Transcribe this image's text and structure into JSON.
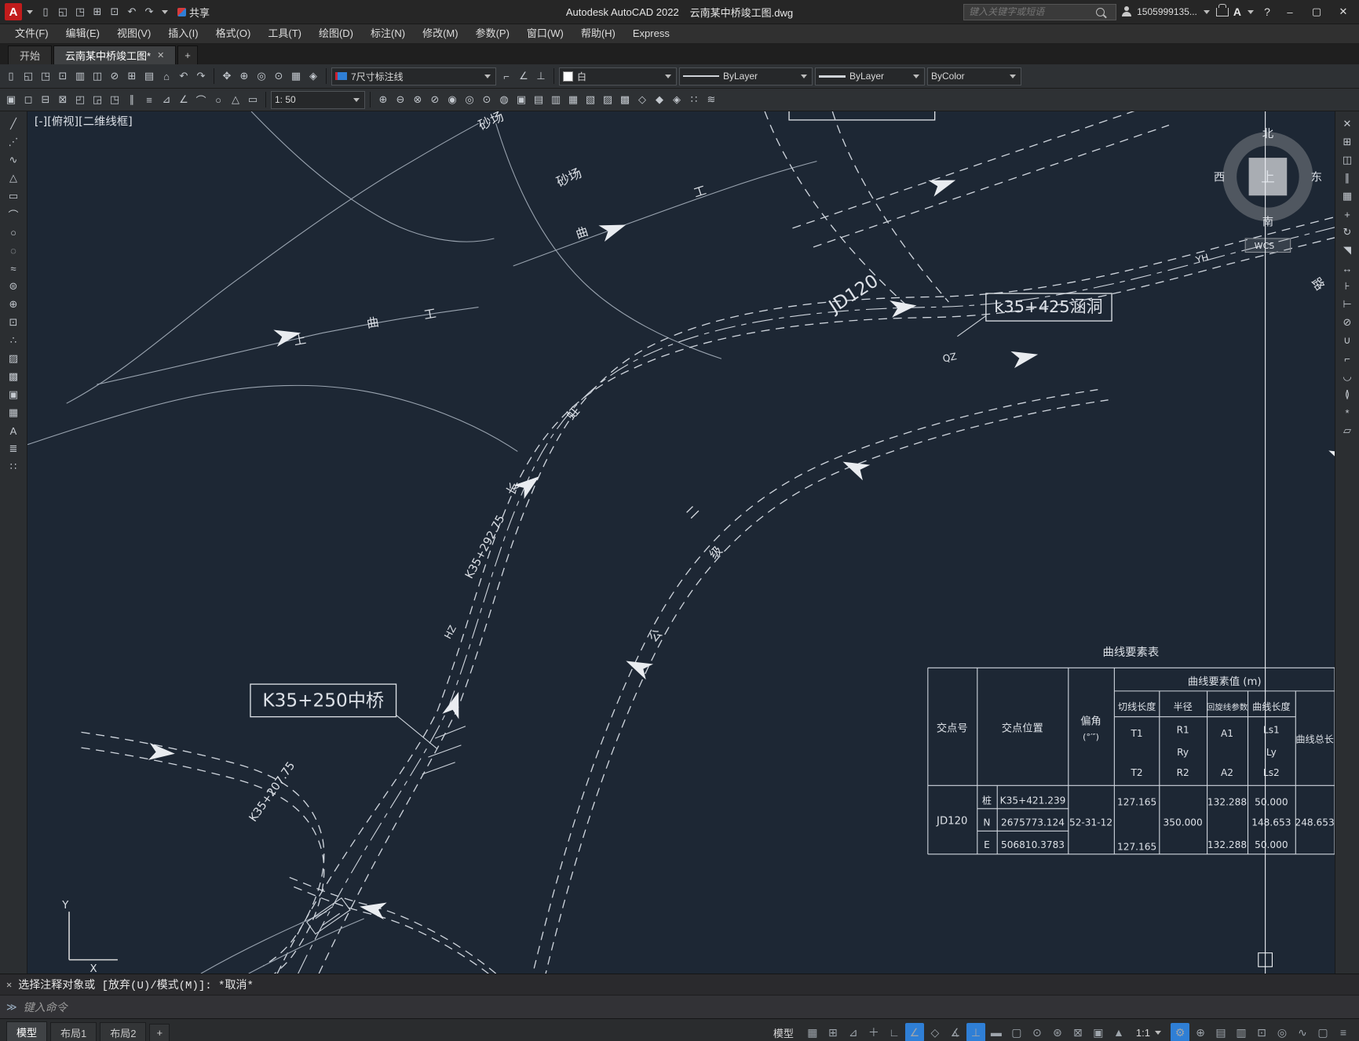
{
  "window": {
    "logo": "A",
    "app_title": "Autodesk AutoCAD 2022",
    "doc_title": "云南某中桥竣工图.dwg",
    "share": "共享",
    "search_placeholder": "键入关键字或短语",
    "user_id": "1505999135...",
    "help": "?",
    "minimize": "–",
    "maximize": "▢",
    "close": "✕"
  },
  "title_icons": [
    {
      "name": "new-file-icon",
      "glyph": "▯"
    },
    {
      "name": "open-folder-icon",
      "glyph": "◱"
    },
    {
      "name": "save-icon",
      "glyph": "◳"
    },
    {
      "name": "save-as-icon",
      "glyph": "⊞"
    },
    {
      "name": "plot-icon",
      "glyph": "⊡"
    },
    {
      "name": "undo-icon",
      "glyph": "↶"
    },
    {
      "name": "redo-icon",
      "glyph": "↷"
    }
  ],
  "menu": {
    "items": [
      "文件(F)",
      "编辑(E)",
      "视图(V)",
      "插入(I)",
      "格式(O)",
      "工具(T)",
      "绘图(D)",
      "标注(N)",
      "修改(M)",
      "参数(P)",
      "窗口(W)",
      "帮助(H)",
      "Express"
    ]
  },
  "tabs": {
    "start": "开始",
    "doc": "云南某中桥竣工图*",
    "close": "✕",
    "add": "+"
  },
  "tb1": {
    "g1": [
      {
        "name": "new-icon",
        "glyph": "▯"
      },
      {
        "name": "open-icon",
        "glyph": "◱"
      },
      {
        "name": "save-icon",
        "glyph": "◳"
      },
      {
        "name": "plot-icon",
        "glyph": "⊡"
      },
      {
        "name": "preview-icon",
        "glyph": "▥"
      },
      {
        "name": "publish-icon",
        "glyph": "◫"
      },
      {
        "name": "cut-icon",
        "glyph": "⊘"
      },
      {
        "name": "copy-clip-icon",
        "glyph": "⊞"
      },
      {
        "name": "paste-icon",
        "glyph": "▤"
      },
      {
        "name": "match-properties-icon",
        "glyph": "⌂"
      },
      {
        "name": "undo-icon",
        "glyph": "↶"
      },
      {
        "name": "redo-icon",
        "glyph": "↷"
      }
    ],
    "g2": [
      {
        "name": "pan-icon",
        "glyph": "✥"
      },
      {
        "name": "zoom-realtime-icon",
        "glyph": "⊕"
      },
      {
        "name": "zoom-window-icon",
        "glyph": "◎"
      },
      {
        "name": "zoom-previous-icon",
        "glyph": "⊙"
      },
      {
        "name": "properties-icon",
        "glyph": "▦"
      },
      {
        "name": "designcenter-icon",
        "glyph": "◈"
      }
    ],
    "dim_style": "7尺寸标注线",
    "g3": [
      {
        "name": "dim-linear-icon",
        "glyph": "⌐"
      },
      {
        "name": "dim-angular-icon",
        "glyph": "∠"
      },
      {
        "name": "dim-radius-icon",
        "glyph": "⊥"
      }
    ],
    "color_label": "白",
    "linetype": "ByLayer",
    "lineweight": "ByLayer",
    "plot_style": "ByColor"
  },
  "tb2": {
    "h1": [
      {
        "name": "layer-properties-icon",
        "glyph": "▣"
      },
      {
        "name": "layer-off-icon",
        "glyph": "◻"
      },
      {
        "name": "layer-freeze-icon",
        "glyph": "⊟"
      },
      {
        "name": "layer-lock-icon",
        "glyph": "⊠"
      },
      {
        "name": "layer-prev-icon",
        "glyph": "◰"
      },
      {
        "name": "layer-state-icon",
        "glyph": "◲"
      },
      {
        "name": "make-current-icon",
        "glyph": "◳"
      },
      {
        "name": "layer-walk-icon",
        "glyph": "∥"
      },
      {
        "name": "layer-merge-icon",
        "glyph": "≡"
      },
      {
        "name": "annotate-icon",
        "glyph": "⊿"
      },
      {
        "name": "mleader-icon",
        "glyph": "∠"
      },
      {
        "name": "arc-tool-icon",
        "glyph": "⌒"
      },
      {
        "name": "circle-tool-icon",
        "glyph": "○"
      },
      {
        "name": "polygon-tool-icon",
        "glyph": "△"
      },
      {
        "name": "rect-tool-icon",
        "glyph": "▭"
      }
    ],
    "scale": "1: 50",
    "h2": [
      {
        "name": "scale-list-icon",
        "glyph": "⊕"
      },
      {
        "name": "ann-update-icon",
        "glyph": "⊖"
      },
      {
        "name": "ann-sync-icon",
        "glyph": "⊗"
      },
      {
        "name": "field-icon",
        "glyph": "⊘"
      },
      {
        "name": "group-icon",
        "glyph": "◉"
      },
      {
        "name": "ungroup-icon",
        "glyph": "◎"
      },
      {
        "name": "group-edit-icon",
        "glyph": "⊙"
      },
      {
        "name": "measure-icon",
        "glyph": "◍"
      },
      {
        "name": "quickcalc-icon",
        "glyph": "▣"
      },
      {
        "name": "block-editor-icon",
        "glyph": "▤"
      },
      {
        "name": "xref-icon",
        "glyph": "▥"
      },
      {
        "name": "image-attach-icon",
        "glyph": "▦"
      },
      {
        "name": "hatch-edit-icon",
        "glyph": "▧"
      },
      {
        "name": "boundary-icon",
        "glyph": "▨"
      },
      {
        "name": "region-icon",
        "glyph": "▩"
      },
      {
        "name": "point-style-icon",
        "glyph": "◇"
      },
      {
        "name": "multiline-icon",
        "glyph": "◆"
      },
      {
        "name": "revcloud-icon",
        "glyph": "◈"
      },
      {
        "name": "divide-icon",
        "glyph": "∷"
      },
      {
        "name": "wipeout-icon",
        "glyph": "≋"
      }
    ]
  },
  "palette_left": [
    {
      "name": "line-tool-icon",
      "glyph": "╱"
    },
    {
      "name": "construction-line-icon",
      "glyph": "⋰"
    },
    {
      "name": "polyline-icon",
      "glyph": "∿"
    },
    {
      "name": "polygon-icon",
      "glyph": "△"
    },
    {
      "name": "rectangle-icon",
      "glyph": "▭"
    },
    {
      "name": "arc-icon",
      "glyph": "⌒"
    },
    {
      "name": "circle-icon",
      "glyph": "○"
    },
    {
      "name": "revision-cloud-icon",
      "glyph": "◌"
    },
    {
      "name": "spline-icon",
      "glyph": "≈"
    },
    {
      "name": "ellipse-icon",
      "glyph": "⊜"
    },
    {
      "name": "insert-block-icon",
      "glyph": "⊕"
    },
    {
      "name": "create-block-icon",
      "glyph": "⊡"
    },
    {
      "name": "point-icon",
      "glyph": "∴"
    },
    {
      "name": "hatch-icon",
      "glyph": "▨"
    },
    {
      "name": "gradient-icon",
      "glyph": "▩"
    },
    {
      "name": "region-icon",
      "glyph": "▣"
    },
    {
      "name": "table-icon",
      "glyph": "▦"
    },
    {
      "name": "text-icon",
      "glyph": "A"
    },
    {
      "name": "mtext-icon",
      "glyph": "≣"
    },
    {
      "name": "point-cloud-icon",
      "glyph": "∷"
    }
  ],
  "palette_right": [
    {
      "name": "erase-icon",
      "glyph": "✕"
    },
    {
      "name": "copy-icon",
      "glyph": "⊞"
    },
    {
      "name": "mirror-icon",
      "glyph": "◫"
    },
    {
      "name": "offset-icon",
      "glyph": "∥"
    },
    {
      "name": "array-icon",
      "glyph": "▦"
    },
    {
      "name": "move-icon",
      "glyph": "+"
    },
    {
      "name": "rotate-icon",
      "glyph": "↻"
    },
    {
      "name": "scale-icon",
      "glyph": "◥"
    },
    {
      "name": "stretch-icon",
      "glyph": "↔"
    },
    {
      "name": "trim-icon",
      "glyph": "⊦"
    },
    {
      "name": "extend-icon",
      "glyph": "⊢"
    },
    {
      "name": "break-icon",
      "glyph": "⊘"
    },
    {
      "name": "join-icon",
      "glyph": "∪"
    },
    {
      "name": "chamfer-icon",
      "glyph": "⌐"
    },
    {
      "name": "fillet-icon",
      "glyph": "◡"
    },
    {
      "name": "blend-icon",
      "glyph": "≬"
    },
    {
      "name": "explode-icon",
      "glyph": "*"
    },
    {
      "name": "align-icon",
      "glyph": "▱"
    }
  ],
  "canvas": {
    "viewport_label": "[-][俯视][二维线框]",
    "viewcube": {
      "n": "北",
      "s": "南",
      "w": "西",
      "e": "东",
      "top": "上",
      "wcs": "WCS"
    },
    "ucs": {
      "x": "X",
      "y": "Y"
    },
    "labels": {
      "sand1": "砂场",
      "sand2": "砂场",
      "jd": "JD120",
      "bridge": "K35+250中桥",
      "culvert": "k35+425涵洞",
      "st1": "K35+292.75",
      "st2": "K35+207.75",
      "hz": "HZ",
      "qz": "QZ",
      "yh": "YH",
      "c1": "曲",
      "c2": "工",
      "c3": "曲",
      "c4": "工",
      "c5": "上",
      "c6": "长",
      "c7": "虹",
      "c8": "二",
      "c9": "级",
      "c10": "公",
      "c11": "路"
    }
  },
  "table": {
    "title": "曲线要素表",
    "headers": {
      "jiaodian": "交点号",
      "weizhi": "交点位置",
      "pianjiao": "偏角",
      "pianjiao_unit": "(°′″)",
      "yaosu": "曲线要素值 (m)",
      "qiexian": "切线长度",
      "banjing": "半径",
      "huixuan": "回旋线参数",
      "quxian": "曲线长度",
      "zongchang": "曲线总长",
      "t1": "T1",
      "t2": "T2",
      "r1": "R1",
      "ry": "Ry",
      "r2": "R2",
      "a1": "A1",
      "a2": "A2",
      "ls1": "Ls1",
      "ly": "Ly",
      "ls2": "Ls2"
    },
    "row": {
      "id": "JD120",
      "zhuang_label": "桩",
      "zhuang": "K35+421.239",
      "n_label": "N",
      "n": "2675773.124",
      "e_label": "E",
      "e": "506810.3783",
      "pianjiao": "52-31-12",
      "t1": "127.165",
      "t2": "127.165",
      "r": "350.000",
      "a1": "132.288",
      "a2": "132.288",
      "ls1": "50.000",
      "ly": "148.653",
      "ls2": "50.000",
      "total": "248.653"
    }
  },
  "cmd": {
    "close": "✕",
    "history": "选择注释对象或 [放弃(U)/模式(M)]: *取消*",
    "prompt_icon": "≫",
    "prompt": "键入命令"
  },
  "status": {
    "tabs": [
      "模型",
      "布局1",
      "布局2"
    ],
    "add": "+",
    "model": "模型",
    "scale": "1:1",
    "icons": [
      {
        "name": "grid-icon",
        "glyph": "▦"
      },
      {
        "name": "snap-mode-icon",
        "glyph": "⊞"
      },
      {
        "name": "infer-constraints-icon",
        "glyph": "⊿"
      },
      {
        "name": "dynamic-input-icon",
        "glyph": "＋"
      },
      {
        "name": "ortho-icon",
        "glyph": "∟"
      },
      {
        "name": "polar-tracking-icon",
        "glyph": "∠",
        "active": true
      },
      {
        "name": "isometric-draft-icon",
        "glyph": "◇"
      },
      {
        "name": "osnap-tracking-icon",
        "glyph": "∡"
      },
      {
        "name": "object-snap-icon",
        "glyph": "⊥",
        "active": true
      },
      {
        "name": "lineweight-icon",
        "glyph": "▬"
      },
      {
        "name": "transparency-icon",
        "glyph": "▢"
      },
      {
        "name": "selection-cycling-icon",
        "glyph": "⊙"
      },
      {
        "name": "3d-osnap-icon",
        "glyph": "⊛"
      },
      {
        "name": "dynamic-ucs-icon",
        "glyph": "⊠"
      },
      {
        "name": "annotation-visibility-icon",
        "glyph": "▣"
      },
      {
        "name": "autoscale-icon",
        "glyph": "▲"
      }
    ],
    "icons2": [
      {
        "name": "workspace-switch-icon",
        "glyph": "⚙",
        "active": true
      },
      {
        "name": "annotation-monitor-icon",
        "glyph": "⊕"
      },
      {
        "name": "units-icon",
        "glyph": "▤"
      },
      {
        "name": "quick-properties-icon",
        "glyph": "▥"
      },
      {
        "name": "lock-ui-icon",
        "glyph": "⊡"
      },
      {
        "name": "isolate-objects-icon",
        "glyph": "◎"
      },
      {
        "name": "graphics-performance-icon",
        "glyph": "∿"
      },
      {
        "name": "clean-screen-icon",
        "glyph": "▢"
      },
      {
        "name": "customization-icon",
        "glyph": "≡"
      }
    ]
  }
}
